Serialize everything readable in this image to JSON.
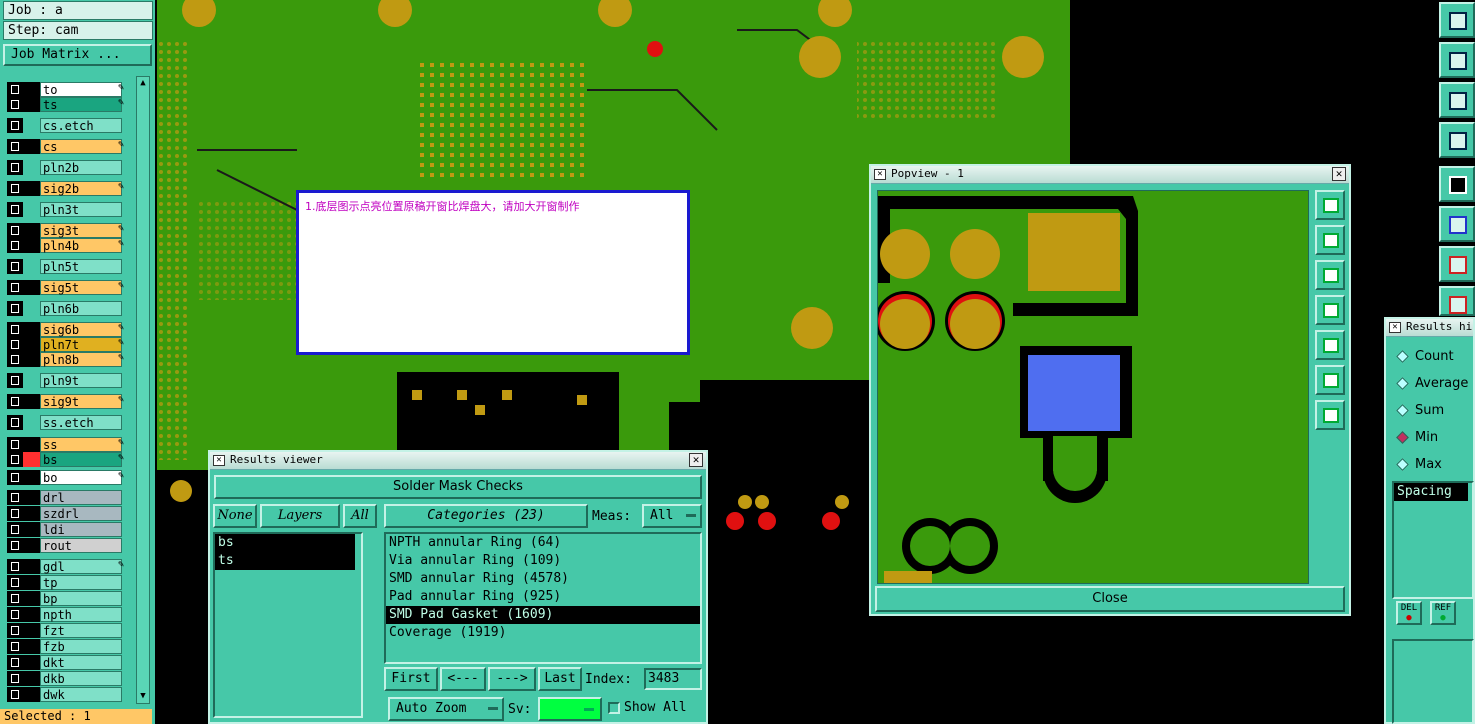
{
  "job": {
    "line1": "Job : a",
    "line2": "Step: cam",
    "matrix_button": "Job Matrix ..."
  },
  "layers": [
    {
      "name": "to",
      "color": "#ffffff",
      "pad": "#000",
      "edit": true
    },
    {
      "name": "ts",
      "color": "#1aa580",
      "pad": "#000",
      "edit": true
    },
    {
      "name": "cs.etch",
      "color": "#7fe0c8",
      "pad": "#46c8a8",
      "edit": false
    },
    {
      "name": "cs",
      "color": "#ffc766",
      "pad": "#000",
      "edit": true
    },
    {
      "name": "pln2b",
      "color": "#7fe0c8",
      "pad": "#46c8a8",
      "edit": false
    },
    {
      "name": "sig2b",
      "color": "#ffc766",
      "pad": "#000",
      "edit": true
    },
    {
      "name": "pln3t",
      "color": "#7fe0c8",
      "pad": "#46c8a8",
      "edit": false
    },
    {
      "name": "sig3t",
      "color": "#ffc766",
      "pad": "#000",
      "edit": true
    },
    {
      "name": "pln4b",
      "color": "#ffc766",
      "pad": "#000",
      "edit": true
    },
    {
      "name": "pln5t",
      "color": "#7fe0c8",
      "pad": "#46c8a8",
      "edit": false
    },
    {
      "name": "sig5t",
      "color": "#ffc766",
      "pad": "#000",
      "edit": true
    },
    {
      "name": "pln6b",
      "color": "#7fe0c8",
      "pad": "#46c8a8",
      "edit": false
    },
    {
      "name": "sig6b",
      "color": "#ffc766",
      "pad": "#000",
      "edit": true
    },
    {
      "name": "pln7t",
      "color": "#e0b020",
      "pad": "#000",
      "edit": true
    },
    {
      "name": "pln8b",
      "color": "#ffc766",
      "pad": "#000",
      "edit": true
    },
    {
      "name": "pln9t",
      "color": "#7fe0c8",
      "pad": "#46c8a8",
      "edit": false
    },
    {
      "name": "sig9t",
      "color": "#ffc766",
      "pad": "#000",
      "edit": true
    },
    {
      "name": "ss.etch",
      "color": "#7fe0c8",
      "pad": "#46c8a8",
      "edit": false
    },
    {
      "name": "ss",
      "color": "#ffc766",
      "pad": "#000",
      "edit": true
    },
    {
      "name": "bs",
      "color": "#1aa580",
      "pad": "#ff3030",
      "edit": true
    },
    {
      "name": "bo",
      "color": "#ffffff",
      "pad": "#000",
      "edit": true
    },
    {
      "name": "drl",
      "color": "#a8b8c0",
      "pad": "#000",
      "edit": false
    },
    {
      "name": "szdrl",
      "color": "#a8b8c0",
      "pad": "#000",
      "edit": false
    },
    {
      "name": "ldi",
      "color": "#a8b8c0",
      "pad": "#000",
      "edit": false
    },
    {
      "name": "rout",
      "color": "#d0d0d0",
      "pad": "#000",
      "edit": false
    },
    {
      "name": "gdl",
      "color": "#7fe0c8",
      "pad": "#000",
      "edit": true
    },
    {
      "name": "tp",
      "color": "#7fe0c8",
      "pad": "#000",
      "edit": false
    },
    {
      "name": "bp",
      "color": "#7fe0c8",
      "pad": "#000",
      "edit": false
    },
    {
      "name": "npth",
      "color": "#7fe0c8",
      "pad": "#000",
      "edit": false
    },
    {
      "name": "fzt",
      "color": "#7fe0c8",
      "pad": "#000",
      "edit": false
    },
    {
      "name": "fzb",
      "color": "#7fe0c8",
      "pad": "#000",
      "edit": false
    },
    {
      "name": "dkt",
      "color": "#7fe0c8",
      "pad": "#000",
      "edit": false
    },
    {
      "name": "dkb",
      "color": "#7fe0c8",
      "pad": "#000",
      "edit": false
    },
    {
      "name": "dwk",
      "color": "#7fe0c8",
      "pad": "#000",
      "edit": false
    }
  ],
  "status": {
    "selected": "Selected : 1"
  },
  "message": {
    "text": "1.底层图示点亮位置原稿开窗比焊盘大，请加大开窗制作"
  },
  "results_viewer": {
    "title": "Results viewer",
    "header": "Solder Mask Checks",
    "none_btn": "None",
    "layers_btn": "Layers",
    "all_btn": "All",
    "categories_btn": "Categories (23)",
    "meas_label": "Meas:",
    "meas_value": "All",
    "layers_list": [
      "bs",
      "ts"
    ],
    "categories_list": [
      "NPTH annular Ring (64)",
      "Via annular Ring (109)",
      "SMD annular Ring (4578)",
      "Pad annular Ring (925)",
      "SMD Pad Gasket (1609)",
      "Coverage (1919)"
    ],
    "selected_category_index": 4,
    "first_btn": "First",
    "prev_btn": "<---",
    "next_btn": "--->",
    "last_btn": "Last",
    "index_label": "Index:",
    "index_value": "3483",
    "zoom_btn": "Auto Zoom",
    "sv_label": "Sv:",
    "show_all": "Show All"
  },
  "popview": {
    "title": "Popview - 1",
    "close_btn": "Close"
  },
  "results_histo": {
    "title": "Results hi",
    "options": [
      "Count",
      "Average",
      "Sum",
      "Min",
      "Max"
    ],
    "selected": "Min",
    "list_item": "Spacing",
    "del_btn": "DEL",
    "ref_btn": "REF"
  },
  "colors": {
    "panel": "#46c8a8",
    "pcb_green": "#3a9a0c",
    "pad_gold": "#c09a12",
    "selection_blue": "#4f6ef0"
  }
}
